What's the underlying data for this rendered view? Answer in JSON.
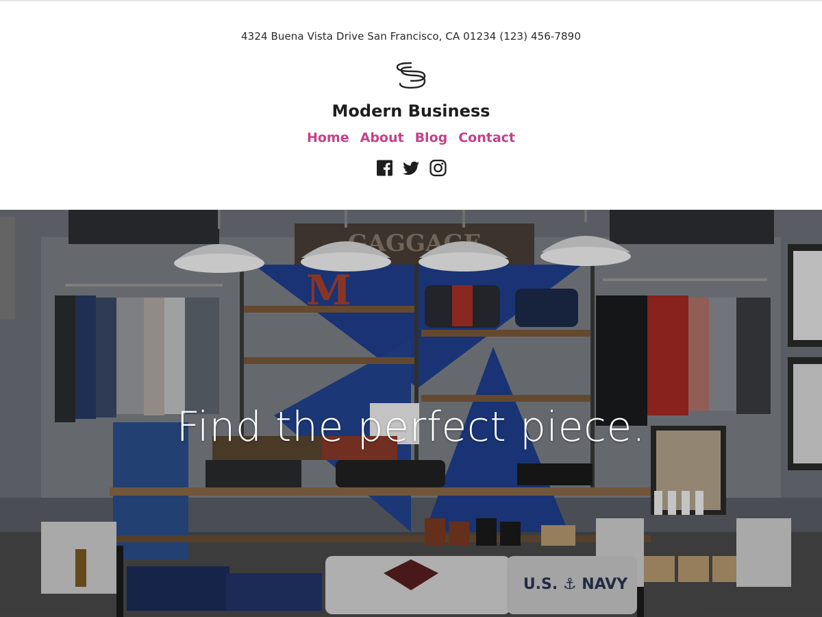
{
  "header": {
    "address": "4324 Buena Vista Drive San Francisco, CA 01234 (123) 456-7890",
    "site_title": "Modern Business",
    "logo_icon": "s-swirl-logo-icon"
  },
  "nav": {
    "items": [
      {
        "label": "Home"
      },
      {
        "label": "About"
      },
      {
        "label": "Blog"
      },
      {
        "label": "Contact"
      }
    ]
  },
  "social": {
    "items": [
      {
        "name": "facebook-icon"
      },
      {
        "name": "twitter-icon"
      },
      {
        "name": "instagram-icon"
      }
    ]
  },
  "hero": {
    "title": "Find the perfect piece.",
    "sign_text": "GAGGAGE",
    "sweater_text": "U.S. ⚓ NAVY",
    "letter_text": "M"
  },
  "colors": {
    "accent": "#c73f8a",
    "text": "#1e1e1e",
    "background": "#ffffff"
  }
}
